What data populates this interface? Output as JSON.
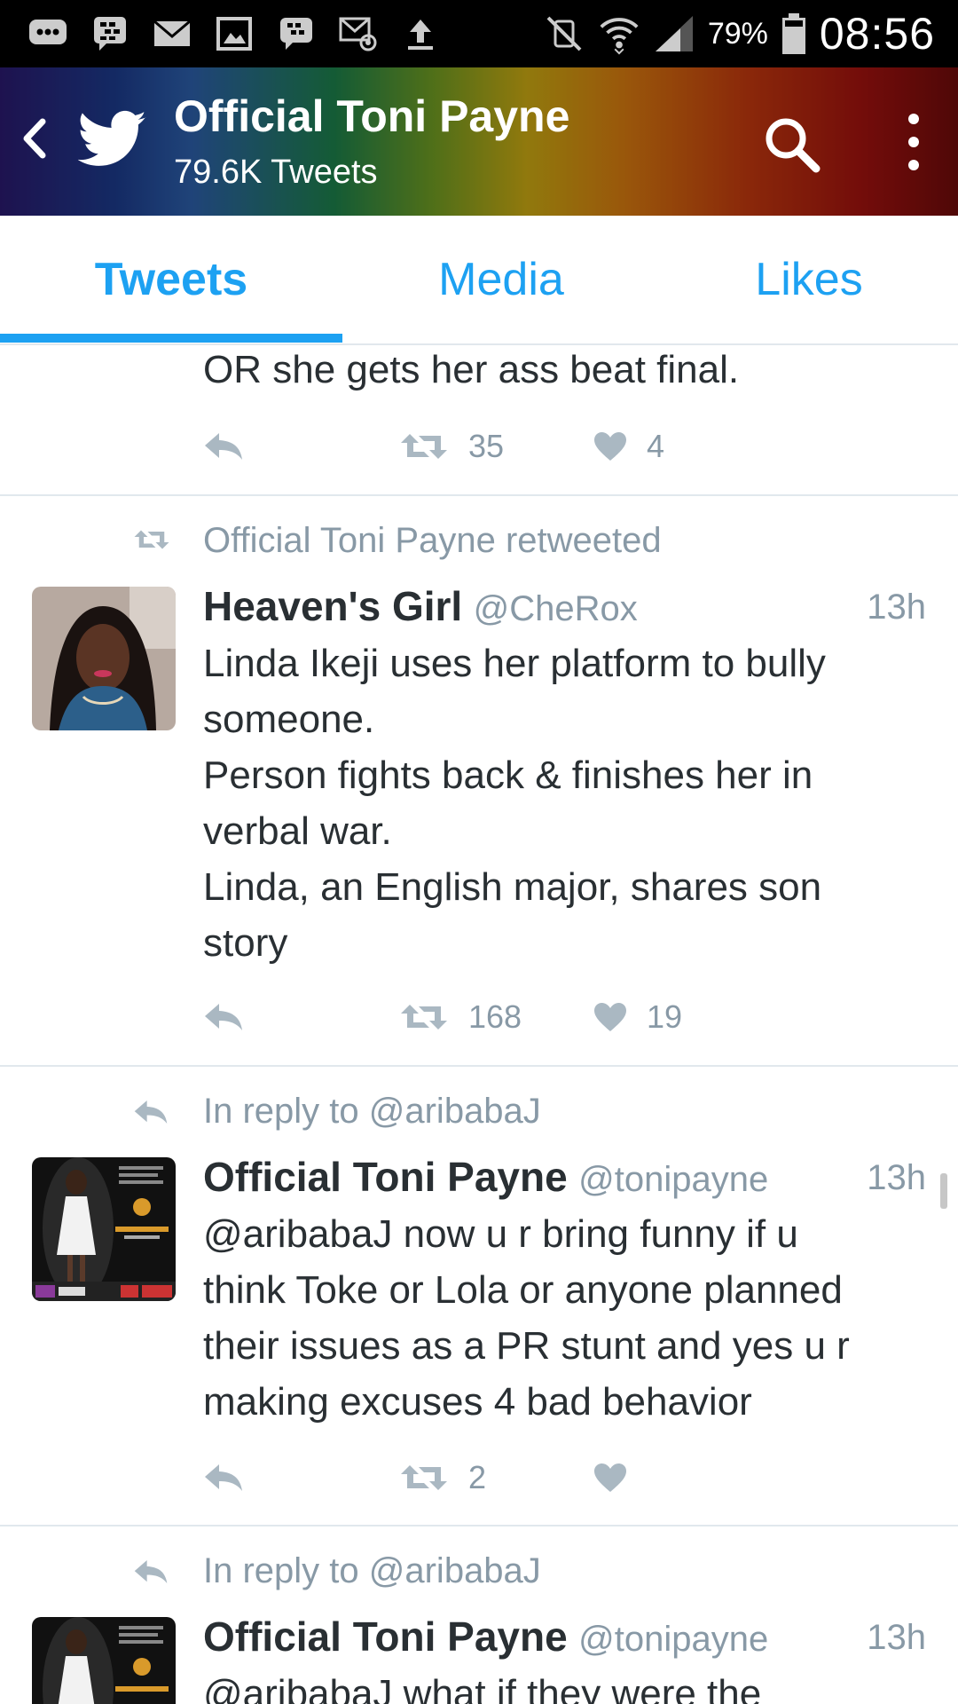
{
  "status_bar": {
    "battery": "79%",
    "time": "08:56"
  },
  "header": {
    "title": "Official Toni Payne",
    "subtitle": "79.6K Tweets"
  },
  "tabs": [
    {
      "label": "Tweets",
      "active": true
    },
    {
      "label": "Media",
      "active": false
    },
    {
      "label": "Likes",
      "active": false
    }
  ],
  "tweets": [
    {
      "text_lines": [
        "OR she gets her ass beat final."
      ],
      "retweets": "35",
      "likes": "4"
    },
    {
      "context": "Official Toni Payne retweeted",
      "name": "Heaven's Girl",
      "handle": "@CheRox",
      "time": "13h",
      "text_lines": [
        "Linda Ikeji uses her platform to bully",
        "someone.",
        "Person fights back & finishes her in",
        "verbal war.",
        "Linda, an English major, shares son",
        "story"
      ],
      "retweets": "168",
      "likes": "19"
    },
    {
      "context": "In reply to @aribabaJ",
      "name": "Official Toni Payne",
      "handle": "@tonipayne",
      "time": "13h",
      "text_lines": [
        "@aribabaJ now u r bring funny if u",
        "think Toke or Lola or anyone planned",
        "their issues as a PR stunt and yes u r",
        "making excuses 4 bad behavior"
      ],
      "retweets": "2",
      "likes": ""
    },
    {
      "context": "In reply to @aribabaJ",
      "name": "Official Toni Payne",
      "handle": "@tonipayne",
      "time": "13h",
      "text_lines": [
        "@aribabaJ what if they were the"
      ]
    }
  ],
  "colors": {
    "accent": "#1da1f2",
    "text": "#292f33",
    "muted": "#8899a6"
  }
}
